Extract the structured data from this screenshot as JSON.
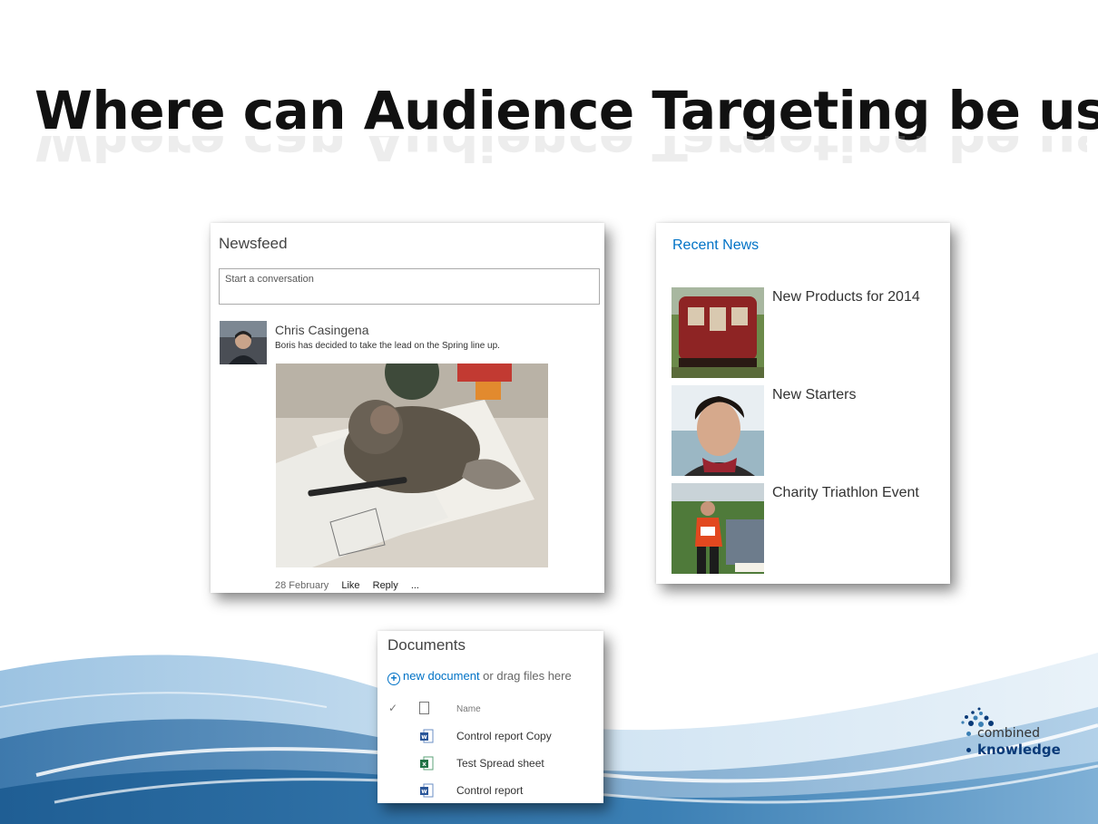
{
  "slide": {
    "title": "Where can Audience Targeting be used?"
  },
  "newsfeed": {
    "heading": "Newsfeed",
    "input_placeholder": "Start a conversation",
    "post": {
      "author": "Chris Casingena",
      "text": "Boris has decided to take the lead on the Spring line up.",
      "date": "28 February",
      "like_label": "Like",
      "reply_label": "Reply",
      "more_label": "..."
    }
  },
  "recent_news": {
    "heading": "Recent News",
    "items": [
      {
        "title": "New Products for 2014",
        "thumb": "red-train-image"
      },
      {
        "title": "New Starters",
        "thumb": "person-portrait-image"
      },
      {
        "title": "Charity Triathlon Event",
        "thumb": "runner-image"
      }
    ]
  },
  "documents": {
    "heading": "Documents",
    "new_link": "new document",
    "new_suffix": " or drag files here",
    "column_name": "Name",
    "files": [
      {
        "name": "Control report Copy",
        "type": "word-icon"
      },
      {
        "name": "Test Spread sheet",
        "type": "excel-icon"
      },
      {
        "name": "Control report",
        "type": "word-icon"
      }
    ]
  },
  "logo": {
    "line1": "combined",
    "line2": "knowledge"
  },
  "colors": {
    "link_blue": "#0072c6",
    "wave_blue": "#3b7fb4",
    "wave_dark": "#1f5e94",
    "logo_navy": "#0a3a78"
  }
}
